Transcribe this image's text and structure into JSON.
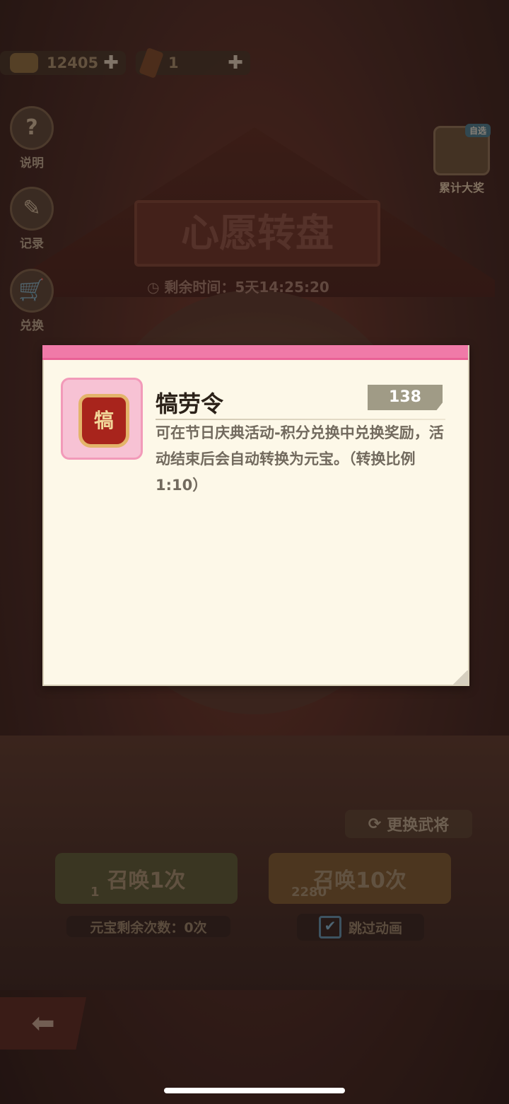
{
  "currency": {
    "gold_amount": "12405",
    "token_amount": "1",
    "plus_symbol": "✚"
  },
  "side_menu": [
    {
      "label": "说明",
      "icon": "help-icon",
      "glyph": "?"
    },
    {
      "label": "记录",
      "icon": "pencil-icon",
      "glyph": "✎"
    },
    {
      "label": "兑换",
      "icon": "cart-icon",
      "glyph": "🛒"
    }
  ],
  "prize": {
    "tag": "自选",
    "label": "累计大奖"
  },
  "board": {
    "title": "心愿转盘",
    "timer": "剩余时间：5天14:25:20"
  },
  "actions": {
    "swap_general": "更换武将",
    "summon_once": "召唤1次",
    "summon_once_cost": "1",
    "summon_ten": "召唤10次",
    "summon_ten_cost": "2280",
    "remaining": "元宝剩余次数：0次",
    "skip_animation": "跳过动画"
  },
  "modal": {
    "item_name": "犒劳令",
    "item_glyph": "犒",
    "count": "138",
    "description": "可在节日庆典活动-积分兑换中兑换奖励，活动结束后会自动转换为元宝。（转换比例1:10）"
  },
  "colors": {
    "modal_header": "#f07aa8",
    "modal_bg": "#fdf8e8",
    "count_badge": "#a09b86"
  }
}
